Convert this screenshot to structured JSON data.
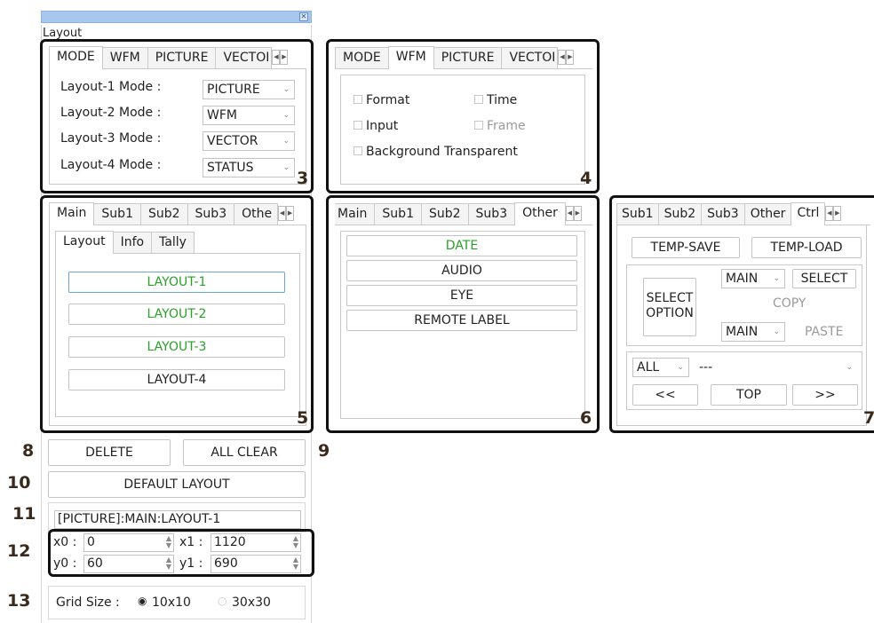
{
  "window": {
    "title": "Layout",
    "close_icon": "close-icon"
  },
  "top_tabs": [
    "MODE",
    "WFM",
    "PICTURE",
    "VECTOI"
  ],
  "mode": {
    "rows": [
      {
        "label": "Layout-1 Mode :",
        "value": "PICTURE"
      },
      {
        "label": "Layout-2 Mode :",
        "value": "WFM"
      },
      {
        "label": "Layout-3 Mode :",
        "value": "VECTOR"
      },
      {
        "label": "Layout-4 Mode :",
        "value": "STATUS"
      }
    ]
  },
  "picture_panel": {
    "checkboxes": {
      "format": "Format",
      "time": "Time",
      "input": "Input",
      "frame": "Frame",
      "background": "Background Transparent"
    }
  },
  "sub_tabs_5": [
    "Main",
    "Sub1",
    "Sub2",
    "Sub3",
    "Othe"
  ],
  "inner_tabs": [
    "Layout",
    "Info",
    "Tally"
  ],
  "layout_buttons": [
    "LAYOUT-1",
    "LAYOUT-2",
    "LAYOUT-3",
    "LAYOUT-4"
  ],
  "sub_tabs_6": [
    "Main",
    "Sub1",
    "Sub2",
    "Sub3",
    "Other"
  ],
  "other_buttons": [
    "DATE",
    "AUDIO",
    "EYE",
    "REMOTE LABEL"
  ],
  "sub_tabs_7": [
    "Sub1",
    "Sub2",
    "Sub3",
    "Other",
    "Ctrl"
  ],
  "ctrl": {
    "temp_save": "TEMP-SAVE",
    "temp_load": "TEMP-LOAD",
    "select_option": "SELECT\nOPTION",
    "main_select_top": "MAIN",
    "select": "SELECT",
    "copy": "COPY",
    "main_select_bottom": "MAIN",
    "paste": "PASTE",
    "all_select": "ALL",
    "target_select": "---",
    "prev": "<<",
    "top": "TOP",
    "next": ">>"
  },
  "actions": {
    "delete": "DELETE",
    "all_clear": "ALL CLEAR",
    "default_layout": "DEFAULT LAYOUT"
  },
  "status_path": "[PICTURE]:MAIN:LAYOUT-1",
  "coords": {
    "x0_label": "x0 :",
    "x0": "0",
    "x1_label": "x1 :",
    "x1": "1120",
    "y0_label": "y0 :",
    "y0": "60",
    "y1_label": "y1 :",
    "y1": "690"
  },
  "grid": {
    "label": "Grid Size :",
    "opt1": "10x10",
    "opt2": "30x30",
    "selected": "10x10"
  },
  "callouts": [
    "3",
    "4",
    "5",
    "6",
    "7",
    "8",
    "9",
    "10",
    "11",
    "12",
    "13"
  ]
}
